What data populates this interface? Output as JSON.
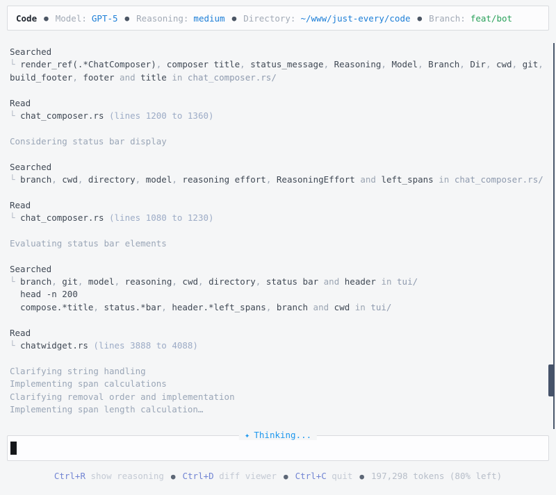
{
  "header": {
    "app_name": "Code",
    "separator": "●",
    "model_label": "Model:",
    "model_value": "GPT-5",
    "reasoning_label": "Reasoning:",
    "reasoning_value": "medium",
    "directory_label": "Directory:",
    "directory_value": "~/www/just-every/code",
    "branch_label": "Branch:",
    "branch_value": "feat/bot"
  },
  "history": {
    "lines": [
      {
        "segments": [
          {
            "t": "Searched",
            "c": "strong"
          }
        ]
      },
      {
        "segments": [
          {
            "t": "└ ",
            "c": "tree"
          },
          {
            "t": "render_ref(.*ChatComposer)",
            "c": "strong"
          },
          {
            "t": ", ",
            "c": "muted"
          },
          {
            "t": "composer title",
            "c": "strong"
          },
          {
            "t": ", ",
            "c": "muted"
          },
          {
            "t": "status_message",
            "c": "strong"
          },
          {
            "t": ", ",
            "c": "muted"
          },
          {
            "t": "Reasoning",
            "c": "strong"
          },
          {
            "t": ", ",
            "c": "muted"
          },
          {
            "t": "Model",
            "c": "strong"
          },
          {
            "t": ", ",
            "c": "muted"
          },
          {
            "t": "Branch",
            "c": "strong"
          },
          {
            "t": ", ",
            "c": "muted"
          },
          {
            "t": "Dir",
            "c": "strong"
          },
          {
            "t": ", ",
            "c": "muted"
          },
          {
            "t": "cwd",
            "c": "strong"
          },
          {
            "t": ", ",
            "c": "muted"
          },
          {
            "t": "git",
            "c": "strong"
          },
          {
            "t": ",",
            "c": "muted"
          }
        ]
      },
      {
        "segments": [
          {
            "t": "build_footer",
            "c": "strong"
          },
          {
            "t": ", ",
            "c": "muted"
          },
          {
            "t": "footer",
            "c": "strong"
          },
          {
            "t": " and ",
            "c": "muted"
          },
          {
            "t": "title",
            "c": "strong"
          },
          {
            "t": " in ",
            "c": "muted"
          },
          {
            "t": "chat_composer.rs/",
            "c": "path"
          }
        ]
      },
      {
        "segments": []
      },
      {
        "segments": [
          {
            "t": "Read",
            "c": "strong"
          }
        ]
      },
      {
        "segments": [
          {
            "t": "└ ",
            "c": "tree"
          },
          {
            "t": "chat_composer.rs",
            "c": "strong"
          },
          {
            "t": " (lines 1200 to 1360)",
            "c": "linesinfo"
          }
        ]
      },
      {
        "segments": []
      },
      {
        "segments": [
          {
            "t": "Considering status bar display",
            "c": "status"
          }
        ]
      },
      {
        "segments": []
      },
      {
        "segments": [
          {
            "t": "Searched",
            "c": "strong"
          }
        ]
      },
      {
        "segments": [
          {
            "t": "└ ",
            "c": "tree"
          },
          {
            "t": "branch",
            "c": "strong"
          },
          {
            "t": ", ",
            "c": "muted"
          },
          {
            "t": "cwd",
            "c": "strong"
          },
          {
            "t": ", ",
            "c": "muted"
          },
          {
            "t": "directory",
            "c": "strong"
          },
          {
            "t": ", ",
            "c": "muted"
          },
          {
            "t": "model",
            "c": "strong"
          },
          {
            "t": ", ",
            "c": "muted"
          },
          {
            "t": "reasoning effort",
            "c": "strong"
          },
          {
            "t": ", ",
            "c": "muted"
          },
          {
            "t": "ReasoningEffort",
            "c": "strong"
          },
          {
            "t": " and ",
            "c": "muted"
          },
          {
            "t": "left_spans",
            "c": "strong"
          },
          {
            "t": " in ",
            "c": "muted"
          },
          {
            "t": "chat_composer.rs/",
            "c": "path"
          }
        ]
      },
      {
        "segments": []
      },
      {
        "segments": [
          {
            "t": "Read",
            "c": "strong"
          }
        ]
      },
      {
        "segments": [
          {
            "t": "└ ",
            "c": "tree"
          },
          {
            "t": "chat_composer.rs",
            "c": "strong"
          },
          {
            "t": " (lines 1080 to 1230)",
            "c": "linesinfo"
          }
        ]
      },
      {
        "segments": []
      },
      {
        "segments": [
          {
            "t": "Evaluating status bar elements",
            "c": "status"
          }
        ]
      },
      {
        "segments": []
      },
      {
        "segments": [
          {
            "t": "Searched",
            "c": "strong"
          }
        ]
      },
      {
        "segments": [
          {
            "t": "└ ",
            "c": "tree"
          },
          {
            "t": "branch",
            "c": "strong"
          },
          {
            "t": ", ",
            "c": "muted"
          },
          {
            "t": "git",
            "c": "strong"
          },
          {
            "t": ", ",
            "c": "muted"
          },
          {
            "t": "model",
            "c": "strong"
          },
          {
            "t": ", ",
            "c": "muted"
          },
          {
            "t": "reasoning",
            "c": "strong"
          },
          {
            "t": ", ",
            "c": "muted"
          },
          {
            "t": "cwd",
            "c": "strong"
          },
          {
            "t": ", ",
            "c": "muted"
          },
          {
            "t": "directory",
            "c": "strong"
          },
          {
            "t": ", ",
            "c": "muted"
          },
          {
            "t": "status bar",
            "c": "strong"
          },
          {
            "t": " and ",
            "c": "muted"
          },
          {
            "t": "header",
            "c": "strong"
          },
          {
            "t": " in ",
            "c": "muted"
          },
          {
            "t": "tui/",
            "c": "path"
          }
        ]
      },
      {
        "segments": [
          {
            "t": "  ",
            "c": "strong"
          },
          {
            "t": "head -n 200",
            "c": "strong"
          }
        ]
      },
      {
        "segments": [
          {
            "t": "  ",
            "c": "strong"
          },
          {
            "t": "compose.*title",
            "c": "strong"
          },
          {
            "t": ", ",
            "c": "muted"
          },
          {
            "t": "status.*bar",
            "c": "strong"
          },
          {
            "t": ", ",
            "c": "muted"
          },
          {
            "t": "header.*left_spans",
            "c": "strong"
          },
          {
            "t": ", ",
            "c": "muted"
          },
          {
            "t": "branch",
            "c": "strong"
          },
          {
            "t": " and ",
            "c": "muted"
          },
          {
            "t": "cwd",
            "c": "strong"
          },
          {
            "t": " in ",
            "c": "muted"
          },
          {
            "t": "tui/",
            "c": "path"
          }
        ]
      },
      {
        "segments": []
      },
      {
        "segments": [
          {
            "t": "Read",
            "c": "strong"
          }
        ]
      },
      {
        "segments": [
          {
            "t": "└ ",
            "c": "tree"
          },
          {
            "t": "chatwidget.rs",
            "c": "strong"
          },
          {
            "t": " (lines 3888 to 4088)",
            "c": "linesinfo"
          }
        ]
      },
      {
        "segments": []
      },
      {
        "segments": [
          {
            "t": "Clarifying string handling",
            "c": "status"
          }
        ]
      },
      {
        "segments": [
          {
            "t": "Implementing span calculations",
            "c": "status"
          }
        ]
      },
      {
        "segments": [
          {
            "t": "Clarifying removal order and implementation",
            "c": "status"
          }
        ]
      },
      {
        "segments": [
          {
            "t": "Implementing span length calculation…",
            "c": "status"
          }
        ]
      }
    ]
  },
  "composer": {
    "status_icon": "✦",
    "status_label": "Thinking...",
    "input_value": ""
  },
  "footer": {
    "separator": "●",
    "shortcuts": [
      {
        "keys": "Ctrl+R",
        "label": "show reasoning"
      },
      {
        "keys": "Ctrl+D",
        "label": "diff viewer"
      },
      {
        "keys": "Ctrl+C",
        "label": "quit"
      }
    ],
    "tokens_text": "197,298 tokens (80% left)"
  },
  "colors": {
    "accent_blue": "#1c7ed7",
    "branch_green": "#2aa15b",
    "thinking_blue": "#1d97ee",
    "shortcut_key": "#7285d3",
    "cursor": "#15171a"
  }
}
